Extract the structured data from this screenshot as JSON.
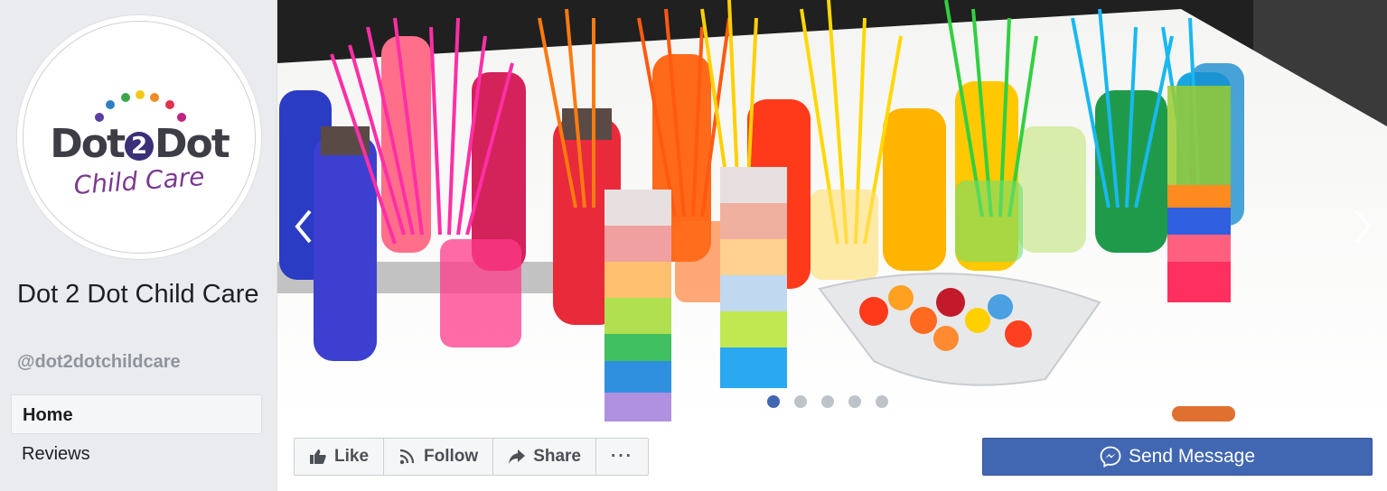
{
  "logo": {
    "main_left": "Dot",
    "main_number": "2",
    "main_right": "Dot",
    "sub": "Child Care",
    "dot_colors": [
      "#5b3fa0",
      "#2f7fc2",
      "#3aa64a",
      "#f2c81a",
      "#f08a24",
      "#e0324b",
      "#c2247f"
    ]
  },
  "page": {
    "name": "Dot 2 Dot Child Care",
    "handle": "@dot2dotchildcare"
  },
  "nav": {
    "items": [
      {
        "label": "Home",
        "active": true
      },
      {
        "label": "Reviews",
        "active": false
      }
    ]
  },
  "cover": {
    "slides_total": 5,
    "active_slide": 1,
    "icons": [
      "chevron-left-icon",
      "chevron-right-icon"
    ]
  },
  "actions": {
    "like": "Like",
    "follow": "Follow",
    "share": "Share",
    "more": "···",
    "send_message": "Send Message"
  },
  "colors": {
    "accent": "#4267b2",
    "background": "#e9ebee"
  }
}
